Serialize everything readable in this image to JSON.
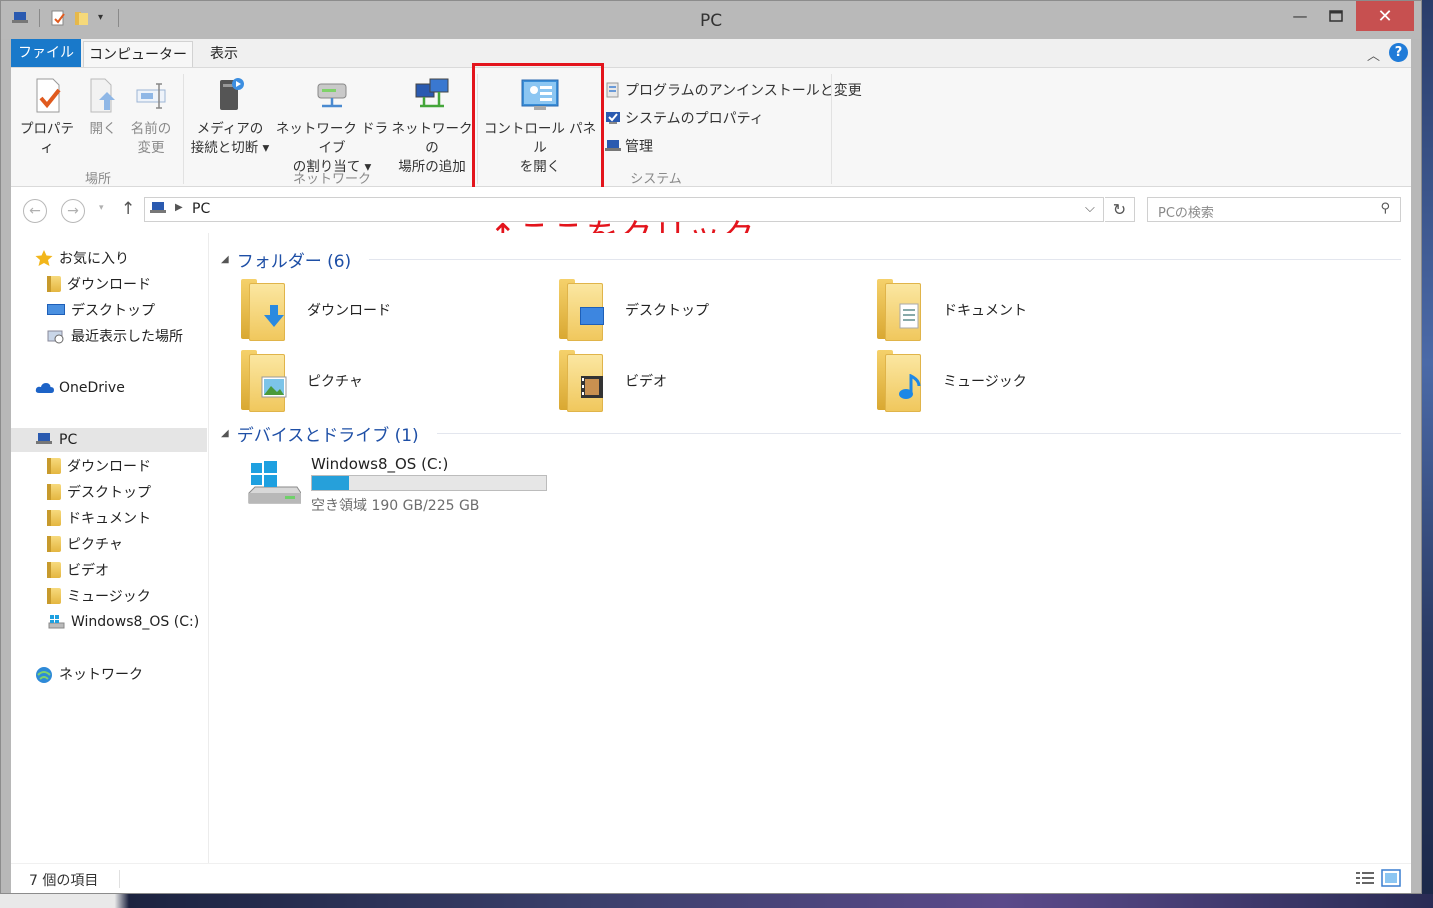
{
  "window": {
    "title": "PC"
  },
  "ribbon": {
    "tabs": [
      "ファイル",
      "コンピューター",
      "表示"
    ],
    "buttons": {
      "properties": "プロパティ",
      "open": "開く",
      "rename_1": "名前の",
      "rename_2": "変更",
      "media_1": "メディアの",
      "media_2": "接続と切断 ▾",
      "map_drive_1": "ネットワーク ドライブ",
      "map_drive_2": "の割り当て ▾",
      "add_network_1": "ネットワークの",
      "add_network_2": "場所の追加",
      "control_panel_1": "コントロール パネル",
      "control_panel_2": "を開く",
      "uninstall": "プログラムのアンインストールと変更",
      "system_props": "システムのプロパティ",
      "manage": "管理"
    },
    "groups": {
      "location": "場所",
      "network": "ネットワーク",
      "system": "システム"
    }
  },
  "annotation": "↑ここをクリック",
  "address": {
    "path": "PC",
    "search_placeholder": "PCの検索"
  },
  "navpane": {
    "favorites": "お気に入り",
    "fav_items": [
      "ダウンロード",
      "デスクトップ",
      "最近表示した場所"
    ],
    "onedrive": "OneDrive",
    "pc": "PC",
    "pc_items": [
      "ダウンロード",
      "デスクトップ",
      "ドキュメント",
      "ピクチャ",
      "ビデオ",
      "ミュージック",
      "Windows8_OS (C:)"
    ],
    "network": "ネットワーク"
  },
  "content": {
    "folders_header": "フォルダー (6)",
    "folders": [
      "ダウンロード",
      "デスクトップ",
      "ドキュメント",
      "ピクチャ",
      "ビデオ",
      "ミュージック"
    ],
    "devices_header": "デバイスとドライブ (1)",
    "drive": {
      "name": "Windows8_OS (C:)",
      "space": "空き領域 190 GB/225 GB",
      "used_fraction": 0.16
    }
  },
  "status": {
    "items": "7 個の項目"
  },
  "colors": {
    "accent": "#1979ca",
    "annotation": "#e3141c",
    "drive_bar": "#26a0da",
    "section_header": "#1e4fa6"
  }
}
